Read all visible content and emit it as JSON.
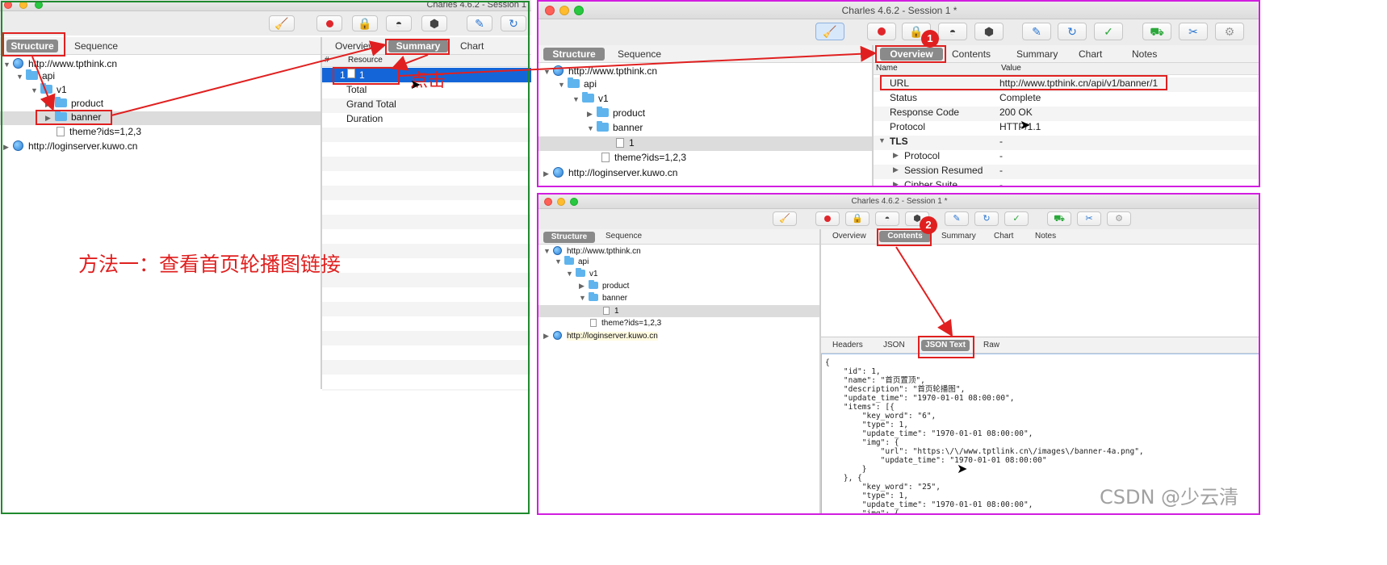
{
  "left_window": {
    "title": "Charles 4.6.2 - Session 1",
    "tabs": {
      "structure": "Structure",
      "sequence": "Sequence"
    },
    "right_tabs": {
      "overview": "Overview",
      "summary": "Summary",
      "chart": "Chart"
    },
    "tree": {
      "host1": "http://www.tpthink.cn",
      "api": "api",
      "v1": "v1",
      "product": "product",
      "banner": "banner",
      "theme": "theme?ids=1,2,3",
      "host2": "http://loginserver.kuwo.cn"
    },
    "summary": {
      "col_num": "#",
      "col_resource": "Resource",
      "row1_num": "1",
      "row1_res": "1",
      "total": "Total",
      "grand_total": "Grand Total",
      "duration": "Duration"
    },
    "click_annotation": "点击",
    "method_annotation": "方法一：查看首页轮播图链接"
  },
  "top_right_window": {
    "title": "Charles 4.6.2 - Session 1 *",
    "tabs": {
      "structure": "Structure",
      "sequence": "Sequence"
    },
    "right_tabs": {
      "overview": "Overview",
      "contents": "Contents",
      "summary": "Summary",
      "chart": "Chart",
      "notes": "Notes"
    },
    "badge": "1",
    "tree": {
      "host1": "http://www.tpthink.cn",
      "api": "api",
      "v1": "v1",
      "product": "product",
      "banner": "banner",
      "item1": "1",
      "theme": "theme?ids=1,2,3",
      "host2": "http://loginserver.kuwo.cn"
    },
    "overview": {
      "col_name": "Name",
      "col_value": "Value",
      "rows": [
        {
          "name": "URL",
          "value": "http://www.tpthink.cn/api/v1/banner/1"
        },
        {
          "name": "Status",
          "value": "Complete"
        },
        {
          "name": "Response Code",
          "value": "200 OK"
        },
        {
          "name": "Protocol",
          "value": "HTTP/1.1"
        },
        {
          "name": "TLS",
          "value": "-"
        },
        {
          "name": "Protocol",
          "value": "-"
        },
        {
          "name": "Session Resumed",
          "value": "-"
        },
        {
          "name": "Cipher Suite",
          "value": "-"
        }
      ]
    }
  },
  "bottom_right_window": {
    "title": "Charles 4.6.2 - Session 1 *",
    "tabs": {
      "structure": "Structure",
      "sequence": "Sequence"
    },
    "right_tabs": {
      "overview": "Overview",
      "contents": "Contents",
      "summary": "Summary",
      "chart": "Chart",
      "notes": "Notes"
    },
    "badge": "2",
    "tree": {
      "host1": "http://www.tpthink.cn",
      "api": "api",
      "v1": "v1",
      "product": "product",
      "banner": "banner",
      "item1": "1",
      "theme": "theme?ids=1,2,3",
      "host2": "http://loginserver.kuwo.cn"
    },
    "sub_tabs": {
      "headers": "Headers",
      "json": "JSON",
      "json_text": "JSON Text",
      "raw": "Raw"
    },
    "json_lines": [
      "{",
      "    \"id\": 1,",
      "    \"name\": \"首页置顶\",",
      "    \"description\": \"首页轮播图\",",
      "    \"update_time\": \"1970-01-01 08:00:00\",",
      "    \"items\": [{",
      "        \"key_word\": \"6\",",
      "        \"type\": 1,",
      "        \"update_time\": \"1970-01-01 08:00:00\",",
      "        \"img\": {",
      "            \"url\": \"https:\\/\\/www.tptlink.cn\\/images\\/banner-4a.png\",",
      "            \"update_time\": \"1970-01-01 08:00:00\"",
      "        }",
      "    }, {",
      "        \"key_word\": \"25\",",
      "        \"type\": 1,",
      "        \"update_time\": \"1970-01-01 08:00:00\",",
      "        \"img\": {"
    ]
  },
  "watermark": "CSDN @少云清",
  "colors": {
    "green_frame": "#1f8a2e",
    "magenta_frame": "#d21ee0",
    "annotation_red": "#e02020",
    "selection_blue": "#1466d8"
  }
}
